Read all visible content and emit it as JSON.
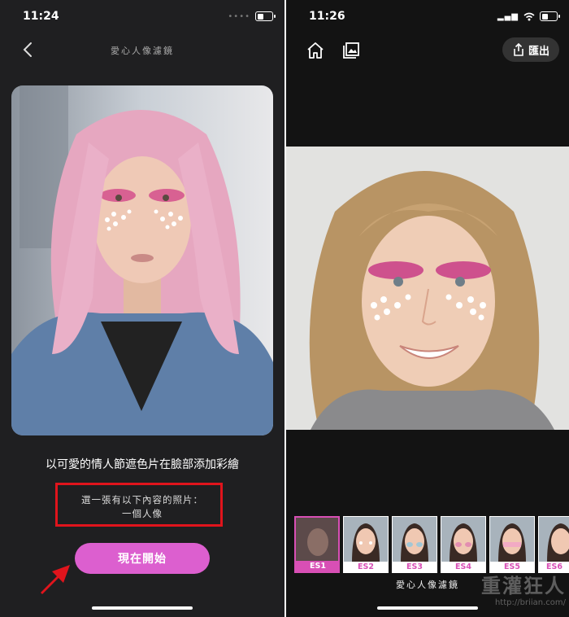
{
  "left_screen": {
    "status_time": "11:24",
    "status_signal": "••••",
    "nav_title": "愛心人像濾鏡",
    "description": "以可愛的情人節遮色片在臉部添加彩繪",
    "requirement_line1": "選一張有以下內容的照片：",
    "requirement_line2": "一個人像",
    "start_label": "現在開始"
  },
  "right_screen": {
    "status_time": "11:26",
    "export_label": "匯出",
    "filter_name": "愛心人像濾鏡",
    "filters": [
      "ES1",
      "ES2",
      "ES3",
      "ES4",
      "ES5",
      "ES6"
    ],
    "selected_filter": "ES1"
  },
  "watermark": {
    "text": "重灌狂人",
    "url": "http://briian.com/"
  },
  "colors": {
    "accent": "#dc5fcf",
    "highlight": "#e0141c",
    "background": "#1f1f21"
  }
}
